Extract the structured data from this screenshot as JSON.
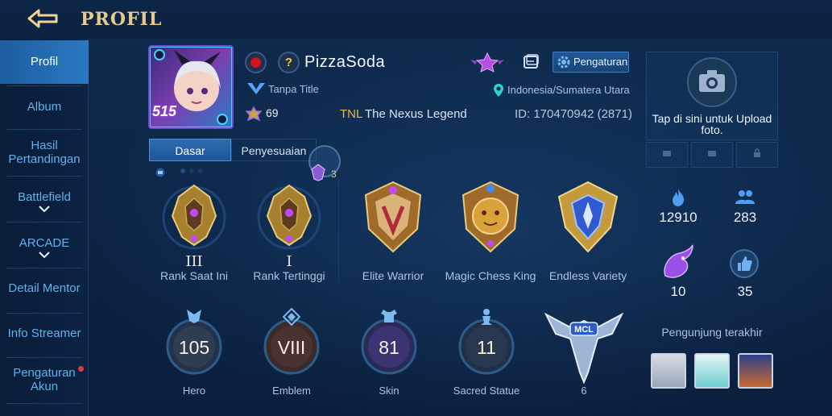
{
  "header": {
    "title": "PROFIL",
    "back_icon": "back-arrow-icon"
  },
  "sidebar": {
    "items": [
      {
        "label": "Profil",
        "active": true
      },
      {
        "label": "Album"
      },
      {
        "label": "Hasil Pertandingan"
      },
      {
        "label": "Battlefield",
        "has_chevron": true
      },
      {
        "label": "ARCADE",
        "has_chevron": true
      },
      {
        "label": "Detail Mentor"
      },
      {
        "label": "Info Streamer"
      },
      {
        "label": "Pengaturan Akun",
        "notification_dot": true
      }
    ]
  },
  "profile": {
    "avatar_level": "515",
    "name": "PizzaSoda",
    "title": "Tanpa Title",
    "popularity": "69",
    "squad_tag": "TNL",
    "squad_name": "The Nexus Legend",
    "location": "Indonesia/Sumatera Utara",
    "id": "ID: 170470942 (2871)",
    "settings_label": "Pengaturan"
  },
  "tabs": [
    {
      "label": "Dasar",
      "active": true
    },
    {
      "label": "Penyesuaian",
      "active": false
    }
  ],
  "ranks": {
    "badge_count": "3",
    "current": {
      "roman": "III",
      "label": "Rank Saat Ini"
    },
    "highest": {
      "roman": "I",
      "label": "Rank Tertinggi"
    },
    "achievements": [
      {
        "label": "Elite Warrior"
      },
      {
        "label": "Magic Chess King"
      },
      {
        "label": "Endless Variety"
      }
    ]
  },
  "stats": [
    {
      "value": "105",
      "label": "Hero"
    },
    {
      "value": "VIII",
      "label": "Emblem"
    },
    {
      "value": "81",
      "label": "Skin"
    },
    {
      "value": "11",
      "label": "Sacred Statue"
    },
    {
      "value": "6",
      "label": ""
    }
  ],
  "right_panel": {
    "upload_text": "Tap di sini untuk Upload foto.",
    "stats": [
      {
        "value": "12910",
        "icon": "flame-icon"
      },
      {
        "value": "283",
        "icon": "people-icon"
      },
      {
        "value": "10",
        "icon": "dragon-icon"
      },
      {
        "value": "35",
        "icon": "thumbs-up-icon"
      }
    ],
    "visitors_label": "Pengunjung terakhir"
  },
  "colors": {
    "accent_gold": "#e9c98b",
    "sidebar_active": "#2a79c2",
    "link_blue": "#5fb2ec"
  }
}
